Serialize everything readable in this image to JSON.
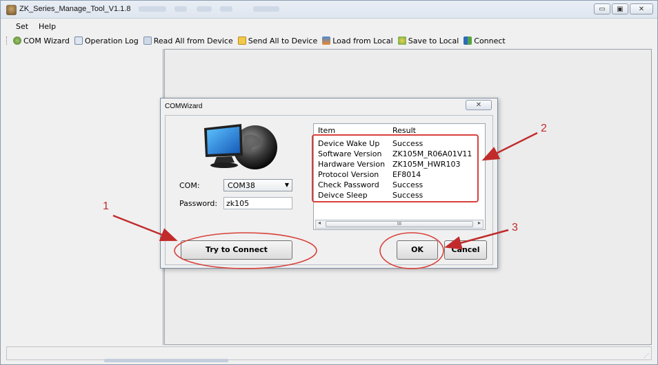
{
  "window": {
    "title": "ZK_Series_Manage_Tool_V1.1.8",
    "controls": [
      "minimize",
      "maximize",
      "close"
    ]
  },
  "menu": [
    "Set",
    "Help"
  ],
  "toolbar": [
    {
      "label": "COM Wizard",
      "icon": "wizard-icon"
    },
    {
      "label": "Operation Log",
      "icon": "log-icon"
    },
    {
      "label": "Read All from Device",
      "icon": "read-device-icon"
    },
    {
      "label": "Send All to Device",
      "icon": "send-device-icon"
    },
    {
      "label": "Load from Local",
      "icon": "load-local-icon"
    },
    {
      "label": "Save to Local",
      "icon": "save-local-icon"
    },
    {
      "label": "Connect",
      "icon": "connect-icon"
    }
  ],
  "dialog": {
    "title": "COMWizard",
    "com_label": "COM:",
    "com_value": "COM38",
    "password_label": "Password:",
    "password_value": "zk105",
    "connect_button": "Try to Connect",
    "ok_button": "OK",
    "cancel_button": "Cancel",
    "list_headers": [
      "Item",
      "Result"
    ],
    "rows": [
      {
        "item": "Device Wake Up",
        "result": "Success"
      },
      {
        "item": "Software Version",
        "result": "ZK105M_R06A01V11"
      },
      {
        "item": "Hardware Version",
        "result": "ZK105M_HWR103"
      },
      {
        "item": "Protocol Version",
        "result": "EF8014"
      },
      {
        "item": "Check Password",
        "result": "Success"
      },
      {
        "item": "Deivce Sleep",
        "result": "Success"
      }
    ],
    "scroll_thumb": "III"
  },
  "annotations": {
    "color": "#c12b2b",
    "labels": [
      "1",
      "2",
      "3"
    ]
  }
}
